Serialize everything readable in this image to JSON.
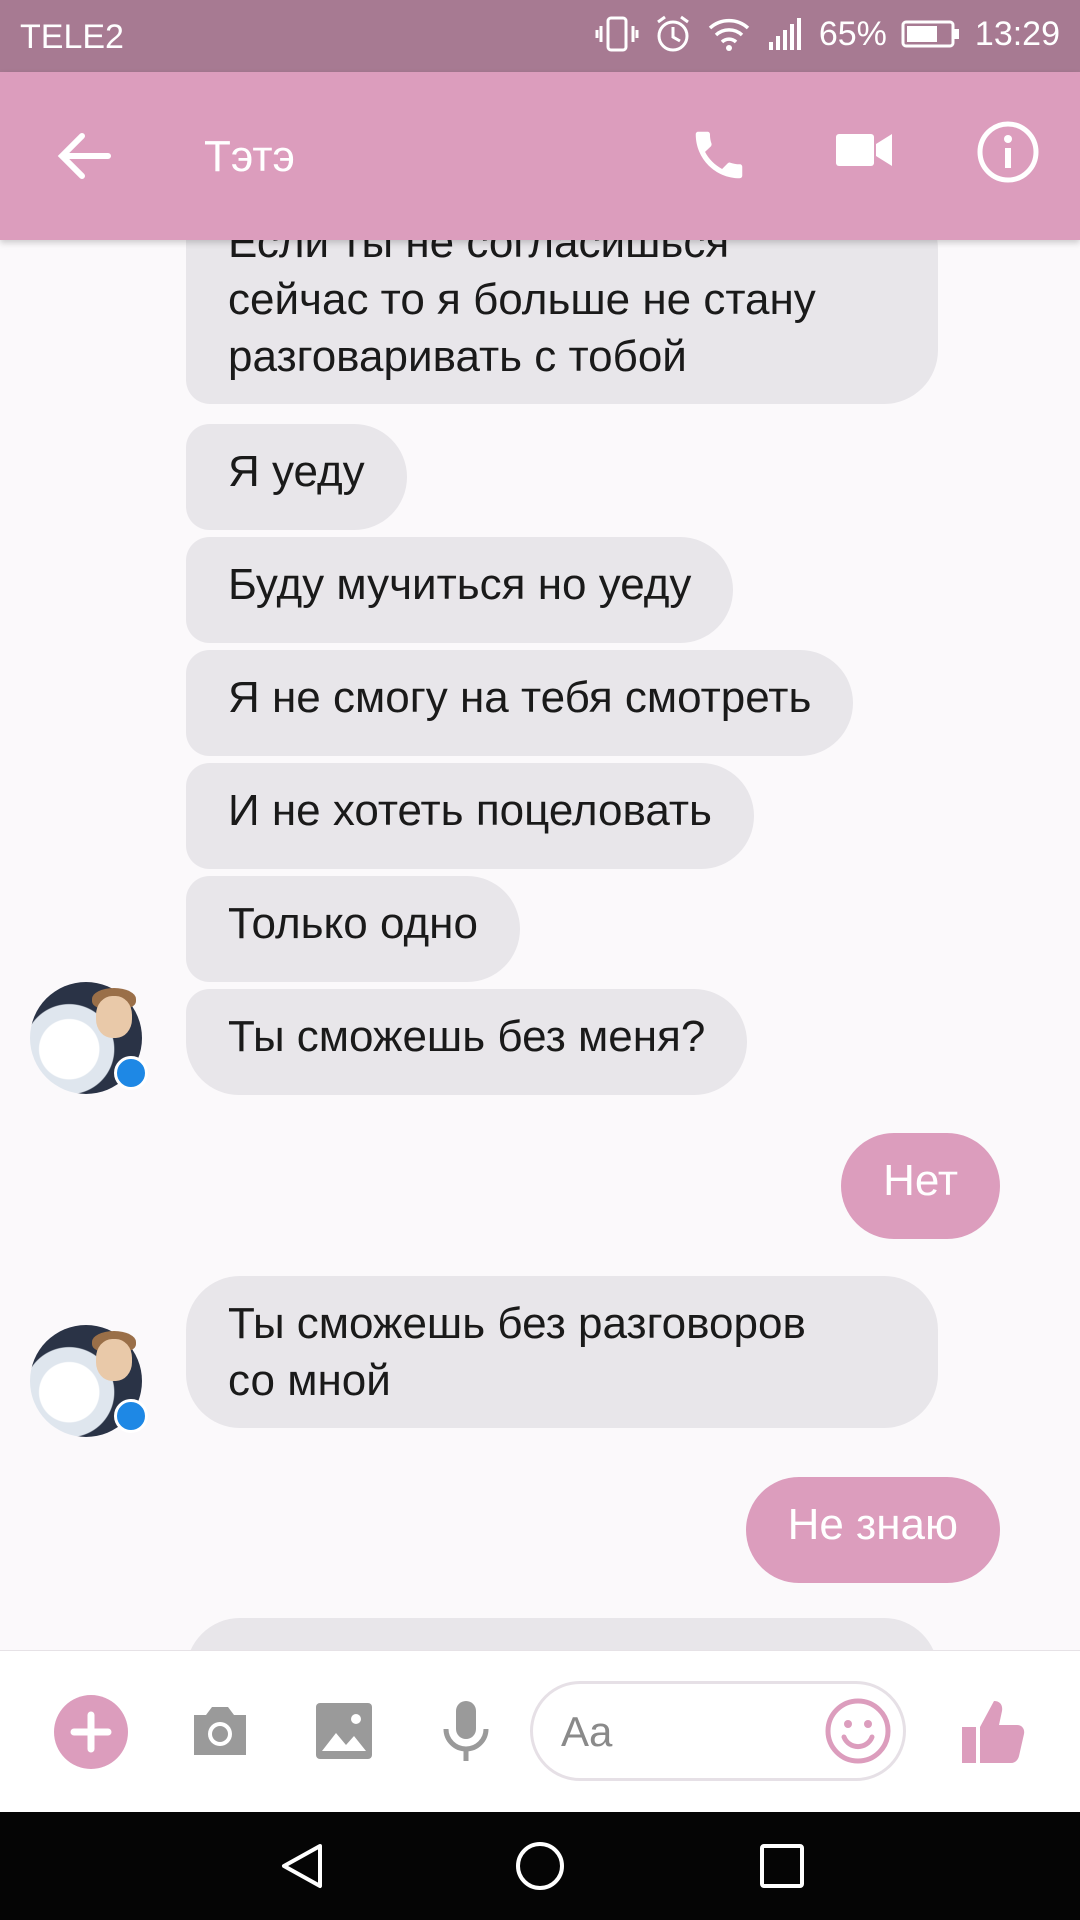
{
  "status_bar": {
    "carrier": "TELE2",
    "battery": "65%",
    "time": "13:29"
  },
  "header": {
    "contact_name": "Тэтэ",
    "icons": [
      "arrow-left-icon",
      "phone-icon",
      "video-camera-icon",
      "info-icon"
    ]
  },
  "messages": [
    {
      "sender": "contact",
      "text": [
        "Если ты не согласишься",
        "сейчас то я больше не стану",
        "разговаривать с тобой"
      ]
    },
    {
      "sender": "contact",
      "text": [
        "Я уеду"
      ]
    },
    {
      "sender": "contact",
      "text": [
        "Буду мучиться но уеду"
      ]
    },
    {
      "sender": "contact",
      "text": [
        "Я не смогу на тебя смотреть"
      ]
    },
    {
      "sender": "contact",
      "text": [
        "И не хотеть поцеловать"
      ]
    },
    {
      "sender": "contact",
      "text": [
        "Только одно"
      ]
    },
    {
      "sender": "contact",
      "text": [
        "Ты сможешь без меня?"
      ]
    },
    {
      "sender": "me",
      "text": [
        "Нет"
      ]
    },
    {
      "sender": "contact",
      "text": [
        "Ты сможешь без разговоров",
        "со мной"
      ]
    },
    {
      "sender": "me",
      "text": [
        "Не знаю"
      ]
    }
  ],
  "composer": {
    "placeholder": "Aa",
    "icons": [
      "plus-icon",
      "camera-icon",
      "image-icon",
      "microphone-icon",
      "emoji-icon",
      "thumbs-up-icon"
    ]
  },
  "colors": {
    "status_bar": "#a77a92",
    "accent": "#dc9dbd",
    "incoming_bubble": "#e8e6ea",
    "background": "#fbf9fb"
  }
}
